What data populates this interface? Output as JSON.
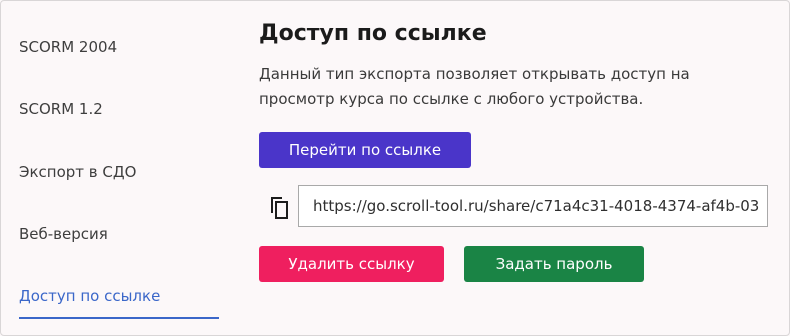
{
  "sidebar": {
    "items": [
      {
        "label": "SCORM 2004"
      },
      {
        "label": "SCORM 1.2"
      },
      {
        "label": "Экспорт в СДО"
      },
      {
        "label": "Веб-версия"
      },
      {
        "label": "Доступ по ссылке",
        "active": true
      }
    ]
  },
  "main": {
    "title": "Доступ по ссылке",
    "description": "Данный тип экспорта позволяет открывать доступ на просмотр курса по ссылке с любого устройства.",
    "goto_button": "Перейти по ссылке",
    "link_value": "https://go.scroll-tool.ru/share/c71a4c31-4018-4374-af4b-03",
    "copy_icon": "copy-icon",
    "delete_button": "Удалить ссылку",
    "password_button": "Задать пароль"
  },
  "colors": {
    "accent": "#3b67c9",
    "goto": "#4a35c9",
    "delete": "#ef1f5f",
    "password": "#1a8445"
  }
}
